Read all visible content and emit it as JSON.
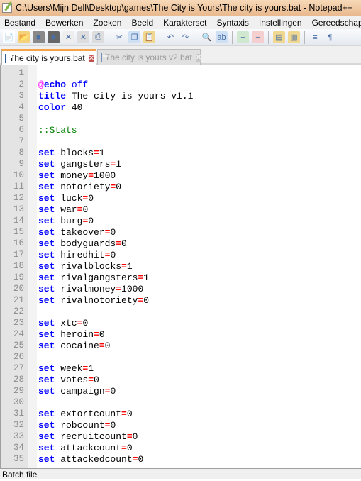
{
  "window": {
    "title": "C:\\Users\\Mijn Dell\\Desktop\\games\\The City is Yours\\The city is yours.bat - Notepad++"
  },
  "menu": [
    "Bestand",
    "Bewerken",
    "Zoeken",
    "Beeld",
    "Karakterset",
    "Syntaxis",
    "Instellingen",
    "Gereedschappe"
  ],
  "toolbar": [
    "new-file",
    "open-file",
    "save",
    "save-all",
    "close",
    "close-all",
    "print",
    "|",
    "cut",
    "copy",
    "paste",
    "|",
    "undo",
    "redo",
    "|",
    "find",
    "replace",
    "|",
    "zoom-in",
    "zoom-out",
    "|",
    "sync-vertical",
    "sync-horizontal",
    "|",
    "word-wrap",
    "show-all-characters"
  ],
  "tabs": [
    {
      "label": "The city is yours.bat",
      "active": true
    },
    {
      "label": "The city is yours v2.bat",
      "active": false
    }
  ],
  "lines": [
    {
      "n": "1",
      "seg": []
    },
    {
      "n": "2",
      "seg": [
        [
          "@",
          "at"
        ],
        [
          "echo",
          "kw"
        ],
        [
          " off",
          "kw2"
        ]
      ]
    },
    {
      "n": "3",
      "seg": [
        [
          "title",
          "kw"
        ],
        [
          " The city is yours v1.1",
          "tx"
        ]
      ]
    },
    {
      "n": "4",
      "seg": [
        [
          "color",
          "kw"
        ],
        [
          " 40",
          "tx"
        ]
      ]
    },
    {
      "n": "5",
      "seg": []
    },
    {
      "n": "6",
      "seg": [
        [
          "::Stats",
          "cm"
        ]
      ]
    },
    {
      "n": "7",
      "seg": []
    },
    {
      "n": "8",
      "seg": [
        [
          "set",
          "kw"
        ],
        [
          " blocks",
          "tx"
        ],
        [
          "=",
          "op"
        ],
        [
          "1",
          "tx"
        ]
      ]
    },
    {
      "n": "9",
      "seg": [
        [
          "set",
          "kw"
        ],
        [
          " gangsters",
          "tx"
        ],
        [
          "=",
          "op"
        ],
        [
          "1",
          "tx"
        ]
      ]
    },
    {
      "n": "10",
      "seg": [
        [
          "set",
          "kw"
        ],
        [
          " money",
          "tx"
        ],
        [
          "=",
          "op"
        ],
        [
          "1000",
          "tx"
        ]
      ]
    },
    {
      "n": "11",
      "seg": [
        [
          "set",
          "kw"
        ],
        [
          " notoriety",
          "tx"
        ],
        [
          "=",
          "op"
        ],
        [
          "0",
          "tx"
        ]
      ]
    },
    {
      "n": "12",
      "seg": [
        [
          "set",
          "kw"
        ],
        [
          " luck",
          "tx"
        ],
        [
          "=",
          "op"
        ],
        [
          "0",
          "tx"
        ]
      ]
    },
    {
      "n": "13",
      "seg": [
        [
          "set",
          "kw"
        ],
        [
          " war",
          "tx"
        ],
        [
          "=",
          "op"
        ],
        [
          "0",
          "tx"
        ]
      ]
    },
    {
      "n": "14",
      "seg": [
        [
          "set",
          "kw"
        ],
        [
          " burg",
          "tx"
        ],
        [
          "=",
          "op"
        ],
        [
          "0",
          "tx"
        ]
      ]
    },
    {
      "n": "15",
      "seg": [
        [
          "set",
          "kw"
        ],
        [
          " takeover",
          "tx"
        ],
        [
          "=",
          "op"
        ],
        [
          "0",
          "tx"
        ]
      ]
    },
    {
      "n": "16",
      "seg": [
        [
          "set",
          "kw"
        ],
        [
          " bodyguards",
          "tx"
        ],
        [
          "=",
          "op"
        ],
        [
          "0",
          "tx"
        ]
      ]
    },
    {
      "n": "17",
      "seg": [
        [
          "set",
          "kw"
        ],
        [
          " hiredhit",
          "tx"
        ],
        [
          "=",
          "op"
        ],
        [
          "0",
          "tx"
        ]
      ]
    },
    {
      "n": "18",
      "seg": [
        [
          "set",
          "kw"
        ],
        [
          " rivalblocks",
          "tx"
        ],
        [
          "=",
          "op"
        ],
        [
          "1",
          "tx"
        ]
      ]
    },
    {
      "n": "19",
      "seg": [
        [
          "set",
          "kw"
        ],
        [
          " rivalgangsters",
          "tx"
        ],
        [
          "=",
          "op"
        ],
        [
          "1",
          "tx"
        ]
      ]
    },
    {
      "n": "20",
      "seg": [
        [
          "set",
          "kw"
        ],
        [
          " rivalmoney",
          "tx"
        ],
        [
          "=",
          "op"
        ],
        [
          "1000",
          "tx"
        ]
      ]
    },
    {
      "n": "21",
      "seg": [
        [
          "set",
          "kw"
        ],
        [
          " rivalnotoriety",
          "tx"
        ],
        [
          "=",
          "op"
        ],
        [
          "0",
          "tx"
        ]
      ]
    },
    {
      "n": "22",
      "seg": []
    },
    {
      "n": "23",
      "seg": [
        [
          "set",
          "kw"
        ],
        [
          " xtc",
          "tx"
        ],
        [
          "=",
          "op"
        ],
        [
          "0",
          "tx"
        ]
      ]
    },
    {
      "n": "24",
      "seg": [
        [
          "set",
          "kw"
        ],
        [
          " heroin",
          "tx"
        ],
        [
          "=",
          "op"
        ],
        [
          "0",
          "tx"
        ]
      ]
    },
    {
      "n": "25",
      "seg": [
        [
          "set",
          "kw"
        ],
        [
          " cocaine",
          "tx"
        ],
        [
          "=",
          "op"
        ],
        [
          "0",
          "tx"
        ]
      ]
    },
    {
      "n": "26",
      "seg": []
    },
    {
      "n": "27",
      "seg": [
        [
          "set",
          "kw"
        ],
        [
          " week",
          "tx"
        ],
        [
          "=",
          "op"
        ],
        [
          "1",
          "tx"
        ]
      ]
    },
    {
      "n": "28",
      "seg": [
        [
          "set",
          "kw"
        ],
        [
          " votes",
          "tx"
        ],
        [
          "=",
          "op"
        ],
        [
          "0",
          "tx"
        ]
      ]
    },
    {
      "n": "29",
      "seg": [
        [
          "set",
          "kw"
        ],
        [
          " campaign",
          "tx"
        ],
        [
          "=",
          "op"
        ],
        [
          "0",
          "tx"
        ]
      ]
    },
    {
      "n": "30",
      "seg": []
    },
    {
      "n": "31",
      "seg": [
        [
          "set",
          "kw"
        ],
        [
          " extortcount",
          "tx"
        ],
        [
          "=",
          "op"
        ],
        [
          "0",
          "tx"
        ]
      ]
    },
    {
      "n": "32",
      "seg": [
        [
          "set",
          "kw"
        ],
        [
          " robcount",
          "tx"
        ],
        [
          "=",
          "op"
        ],
        [
          "0",
          "tx"
        ]
      ]
    },
    {
      "n": "33",
      "seg": [
        [
          "set",
          "kw"
        ],
        [
          " recruitcount",
          "tx"
        ],
        [
          "=",
          "op"
        ],
        [
          "0",
          "tx"
        ]
      ]
    },
    {
      "n": "34",
      "seg": [
        [
          "set",
          "kw"
        ],
        [
          " attackcount",
          "tx"
        ],
        [
          "=",
          "op"
        ],
        [
          "0",
          "tx"
        ]
      ]
    },
    {
      "n": "35",
      "seg": [
        [
          "set",
          "kw"
        ],
        [
          " attackedcount",
          "tx"
        ],
        [
          "=",
          "op"
        ],
        [
          "0",
          "tx"
        ]
      ]
    }
  ],
  "status": {
    "file_type": "Batch file"
  }
}
